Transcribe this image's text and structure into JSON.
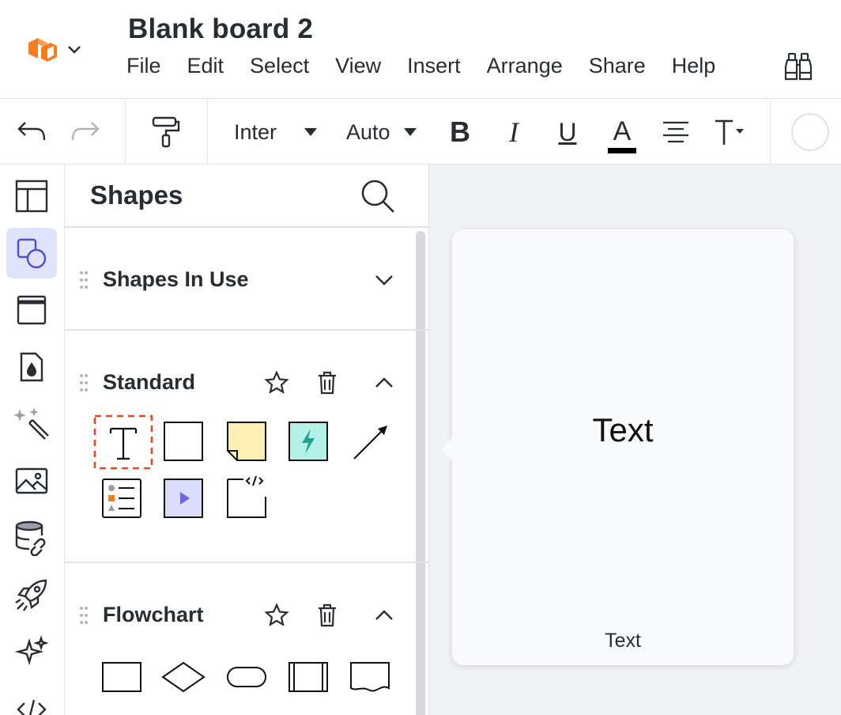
{
  "header": {
    "title": "Blank board 2",
    "menu": [
      "File",
      "Edit",
      "Select",
      "View",
      "Insert",
      "Arrange",
      "Share",
      "Help"
    ]
  },
  "toolbar": {
    "font": "Inter",
    "size": "Auto",
    "bold": "B",
    "italic": "I",
    "underline": "U",
    "text_color_letter": "A",
    "text_color": "#000000"
  },
  "panel": {
    "title": "Shapes",
    "sections": [
      {
        "title": "Shapes In Use"
      },
      {
        "title": "Standard"
      },
      {
        "title": "Flowchart"
      }
    ]
  },
  "tooltip": {
    "preview": "Text",
    "label": "Text"
  },
  "colors": {
    "accent": "#e0e3fb",
    "logo_orange": "#f57c1f",
    "sticky_fill": "#fcefb4",
    "action_fill": "#b4f0e6",
    "action_bolt": "#1fa38e",
    "video_fill": "#dcdcfc",
    "video_play": "#6a66e0",
    "selection_dash": "#e04a25"
  }
}
